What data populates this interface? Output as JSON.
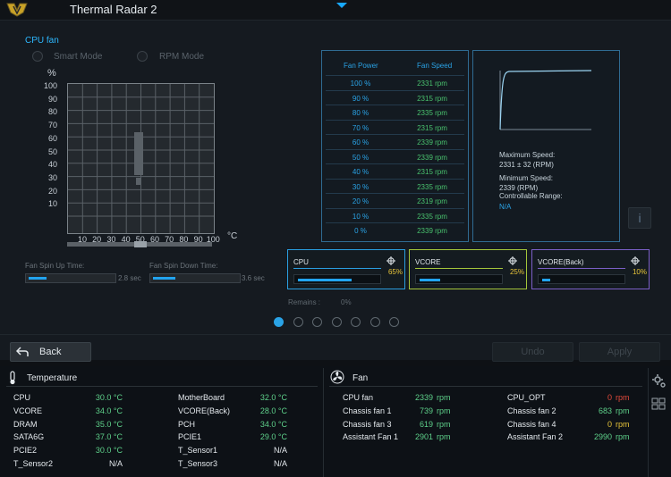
{
  "app": {
    "title": "Thermal Radar 2"
  },
  "fan_section": {
    "label": "CPU fan",
    "modes": [
      {
        "label": "Smart Mode"
      },
      {
        "label": "RPM Mode"
      }
    ]
  },
  "graph": {
    "y_unit": "%",
    "x_unit": "°C",
    "y_ticks": [
      "100",
      "90",
      "80",
      "70",
      "60",
      "50",
      "40",
      "30",
      "20",
      "10"
    ],
    "x_ticks": [
      "10",
      "20",
      "30",
      "40",
      "50",
      "60",
      "70",
      "80",
      "90",
      "100"
    ],
    "warning_glyph": "!"
  },
  "spin": {
    "up": {
      "label": "Fan Spin Up Time:",
      "value": "2.8 sec",
      "fill": 0.2
    },
    "down": {
      "label": "Fan Spin Down Time:",
      "value": "3.6 sec",
      "fill": 0.25
    }
  },
  "table": {
    "headers": [
      "Fan Power",
      "Fan Speed"
    ],
    "rows": [
      [
        "100 %",
        "2331 rpm"
      ],
      [
        "90 %",
        "2315 rpm"
      ],
      [
        "80 %",
        "2335 rpm"
      ],
      [
        "70 %",
        "2315 rpm"
      ],
      [
        "60 %",
        "2339 rpm"
      ],
      [
        "50 %",
        "2339 rpm"
      ],
      [
        "40 %",
        "2315 rpm"
      ],
      [
        "30 %",
        "2335 rpm"
      ],
      [
        "20 %",
        "2319 rpm"
      ],
      [
        "10 %",
        "2335 rpm"
      ],
      [
        "0 %",
        "2339 rpm"
      ]
    ]
  },
  "info": {
    "max_label": "Maximum Speed:",
    "max_value": "2331 ± 32 (RPM)",
    "min_label": "Minimum Speed:",
    "min_value": "2339 (RPM)",
    "range_label": "Controllable Range:",
    "range_value": "N/A",
    "info_icon": "i"
  },
  "sensors": [
    {
      "name": "CPU",
      "percent": "65%",
      "fill": 0.65,
      "color": "#2a9ee0"
    },
    {
      "name": "VCORE",
      "percent": "25%",
      "fill": 0.25,
      "color": "#a4c63a"
    },
    {
      "name": "VCORE(Back)",
      "percent": "10%",
      "fill": 0.1,
      "color": "#7b5fc7"
    }
  ],
  "remains": {
    "label": "Remains :",
    "value": "0%"
  },
  "pager": {
    "count": 7,
    "active": 0
  },
  "buttons": {
    "back": "Back",
    "undo": "Undo",
    "apply": "Apply"
  },
  "temperature": {
    "title": "Temperature",
    "left": [
      {
        "name": "CPU",
        "value": "30.0 °C"
      },
      {
        "name": "VCORE",
        "value": "34.0 °C"
      },
      {
        "name": "DRAM",
        "value": "35.0 °C"
      },
      {
        "name": "SATA6G",
        "value": "37.0 °C"
      },
      {
        "name": "PCIE2",
        "value": "30.0 °C"
      },
      {
        "name": "T_Sensor2",
        "value": "N/A"
      }
    ],
    "right": [
      {
        "name": "MotherBoard",
        "value": "32.0 °C"
      },
      {
        "name": "VCORE(Back)",
        "value": "28.0 °C"
      },
      {
        "name": "PCH",
        "value": "34.0 °C"
      },
      {
        "name": "PCIE1",
        "value": "29.0 °C"
      },
      {
        "name": "T_Sensor1",
        "value": "N/A"
      },
      {
        "name": "T_Sensor3",
        "value": "N/A"
      }
    ]
  },
  "fans": {
    "title": "Fan",
    "left": [
      {
        "name": "CPU fan",
        "value": "2339",
        "unit": "rpm"
      },
      {
        "name": "Chassis fan 1",
        "value": "739",
        "unit": "rpm"
      },
      {
        "name": "Chassis fan 3",
        "value": "619",
        "unit": "rpm"
      },
      {
        "name": "Assistant Fan 1",
        "value": "2901",
        "unit": "rpm"
      }
    ],
    "right": [
      {
        "name": "CPU_OPT",
        "value": "0",
        "unit": "rpm",
        "color": "#e24a3b"
      },
      {
        "name": "Chassis fan 2",
        "value": "683",
        "unit": "rpm"
      },
      {
        "name": "Chassis fan 4",
        "value": "0",
        "unit": "rpm",
        "color": "#e8c53a"
      },
      {
        "name": "Assistant Fan 2",
        "value": "2990",
        "unit": "rpm"
      }
    ]
  }
}
